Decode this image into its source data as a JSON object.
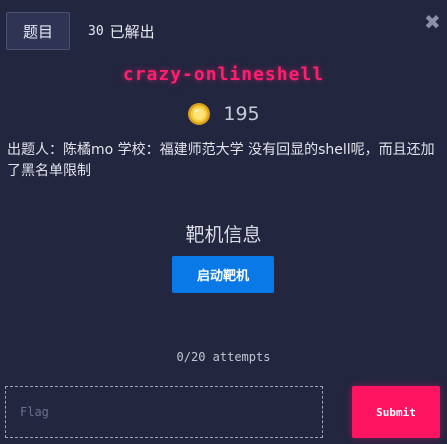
{
  "tabs": {
    "challenge_label": "题目",
    "solves_count": "30",
    "solves_label": "已解出"
  },
  "close_icon": "close-icon",
  "challenge": {
    "title": "crazy-onlineshell",
    "points": "195",
    "points_icon": "coin-icon",
    "description": "出题人：陈橘mo 学校：福建师范大学 没有回显的shell呢，而且还加了黑名单限制"
  },
  "target": {
    "heading": "靶机信息",
    "start_button_label": "启动靶机"
  },
  "attempts": "0/20 attempts",
  "flag_form": {
    "placeholder": "Flag",
    "value": "",
    "submit_label": "Submit"
  },
  "colors": {
    "background": "#22263f",
    "title": "#ff1f6e",
    "start_button": "#0a79e8",
    "submit_button": "#ff1462"
  }
}
